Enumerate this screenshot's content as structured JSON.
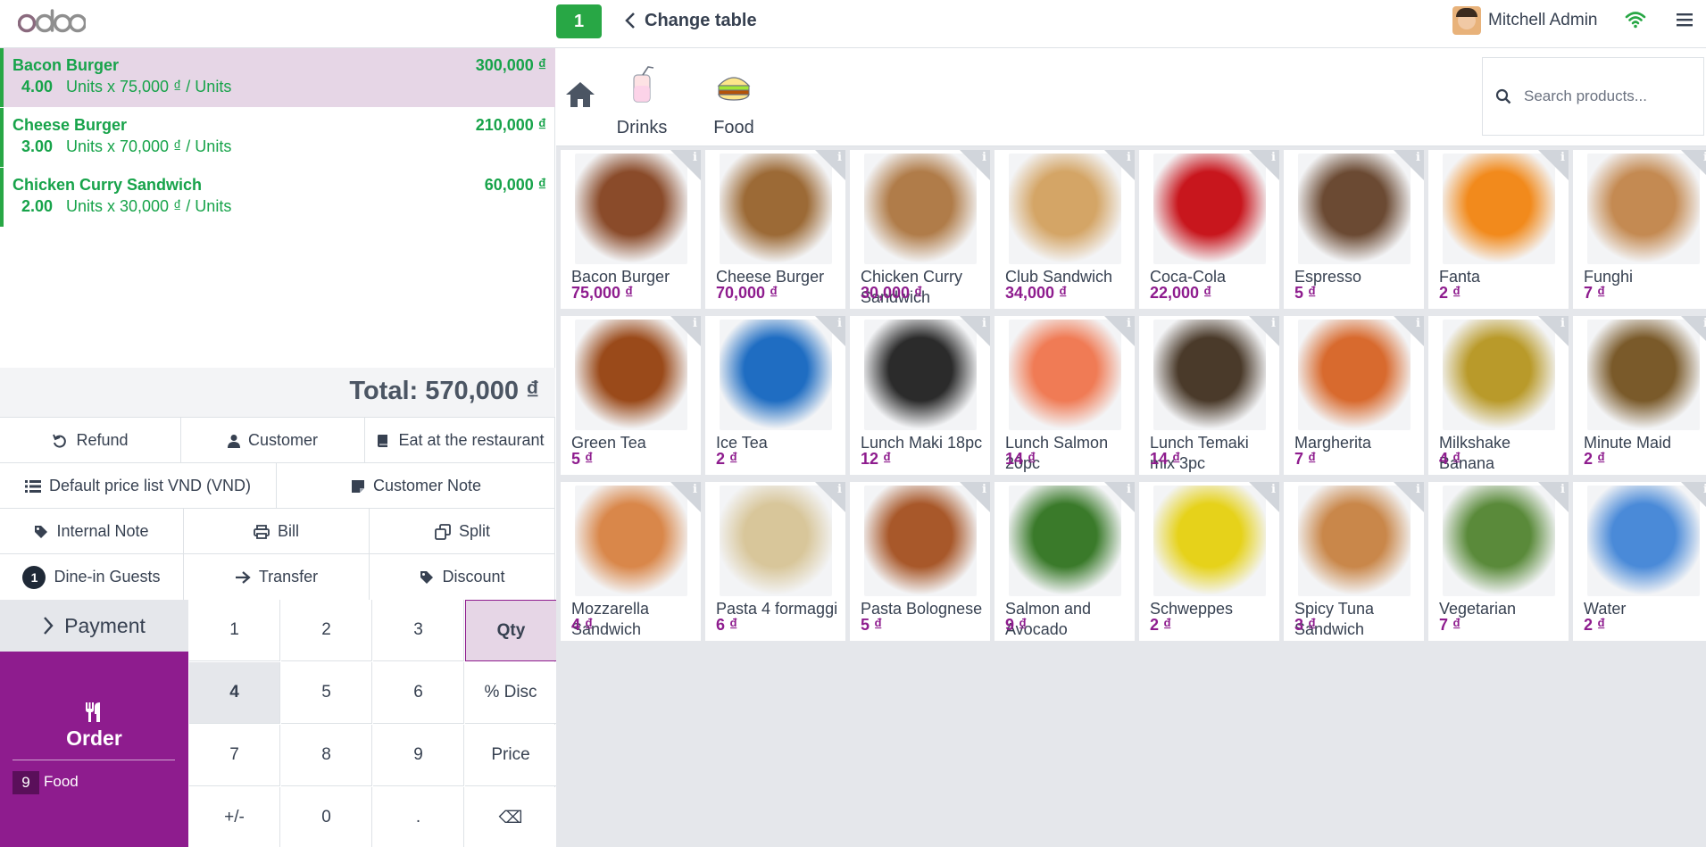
{
  "header": {
    "logo_text": "odoo",
    "table_number": "1",
    "change_table_label": "Change table",
    "user_name": "Mitchell Admin",
    "wifi_icon": "wifi-icon",
    "menu_icon": "hamburger-menu-icon"
  },
  "orderlines": [
    {
      "name": "Bacon Burger",
      "price": "300,000 ₫",
      "qty": "4.00",
      "units": "Units x 75,000 ₫ / Units",
      "selected": true
    },
    {
      "name": "Cheese Burger",
      "price": "210,000 ₫",
      "qty": "3.00",
      "units": "Units x 70,000 ₫ / Units",
      "selected": false
    },
    {
      "name": "Chicken Curry Sandwich",
      "price": "60,000 ₫",
      "qty": "2.00",
      "units": "Units x 30,000 ₫ / Units",
      "selected": false
    }
  ],
  "total": "Total: 570,000 ₫",
  "controls": {
    "refund": "Refund",
    "customer": "Customer",
    "eat_in": "Eat at the restaurant",
    "pricelist": "Default price list VND (VND)",
    "customer_note": "Customer Note",
    "internal_note": "Internal Note",
    "bill": "Bill",
    "split": "Split",
    "guests_count": "1",
    "guests": "Dine-in Guests",
    "transfer": "Transfer",
    "discount": "Discount"
  },
  "payment_label": "Payment",
  "order_button": {
    "label": "Order",
    "count": "9",
    "category": "Food"
  },
  "numpad": {
    "keys": [
      "1",
      "2",
      "3",
      "Qty",
      "4",
      "5",
      "6",
      "% Disc",
      "7",
      "8",
      "9",
      "Price",
      "+/-",
      "0",
      ".",
      "⌫"
    ]
  },
  "categories": [
    {
      "name": "Drinks",
      "icon": "drink-icon"
    },
    {
      "name": "Food",
      "icon": "food-icon"
    }
  ],
  "search": {
    "placeholder": "Search products..."
  },
  "products": [
    {
      "name": "Bacon Burger",
      "price": "75,000 ₫",
      "color": "#8a4b2a"
    },
    {
      "name": "Cheese Burger",
      "price": "70,000 ₫",
      "color": "#9c6a36"
    },
    {
      "name": "Chicken Curry Sandwich",
      "price": "30,000 ₫",
      "color": "#b07c49"
    },
    {
      "name": "Club Sandwich",
      "price": "34,000 ₫",
      "color": "#d4a566"
    },
    {
      "name": "Coca-Cola",
      "price": "22,000 ₫",
      "color": "#c8161d"
    },
    {
      "name": "Espresso",
      "price": "5 ₫",
      "color": "#6b4a33"
    },
    {
      "name": "Fanta",
      "price": "2 ₫",
      "color": "#f28a1c"
    },
    {
      "name": "Funghi",
      "price": "7 ₫",
      "color": "#c48a52"
    },
    {
      "name": "Green Tea",
      "price": "5 ₫",
      "color": "#9a4a1a"
    },
    {
      "name": "Ice Tea",
      "price": "2 ₫",
      "color": "#1f6dc2"
    },
    {
      "name": "Lunch Maki 18pc",
      "price": "12 ₫",
      "color": "#2b2b2b"
    },
    {
      "name": "Lunch Salmon 20pc",
      "price": "14 ₫",
      "color": "#f07b55"
    },
    {
      "name": "Lunch Temaki mix 3pc",
      "price": "14 ₫",
      "color": "#4a3a2a"
    },
    {
      "name": "Margherita",
      "price": "7 ₫",
      "color": "#d86a2e"
    },
    {
      "name": "Milkshake Banana",
      "price": "4 ₫",
      "color": "#b99a2a"
    },
    {
      "name": "Minute Maid",
      "price": "2 ₫",
      "color": "#7a5a2a"
    },
    {
      "name": "Mozzarella Sandwich",
      "price": "4 ₫",
      "color": "#d9874a"
    },
    {
      "name": "Pasta 4 formaggi",
      "price": "6 ₫",
      "color": "#d8c69a"
    },
    {
      "name": "Pasta Bolognese",
      "price": "5 ₫",
      "color": "#a8582a"
    },
    {
      "name": "Salmon and Avocado",
      "price": "9 ₫",
      "color": "#3a7a2a"
    },
    {
      "name": "Schweppes",
      "price": "2 ₫",
      "color": "#e6d21a"
    },
    {
      "name": "Spicy Tuna Sandwich",
      "price": "3 ₫",
      "color": "#c9874a"
    },
    {
      "name": "Vegetarian",
      "price": "7 ₫",
      "color": "#5a8a3a"
    },
    {
      "name": "Water",
      "price": "2 ₫",
      "color": "#4a8ad8"
    }
  ]
}
